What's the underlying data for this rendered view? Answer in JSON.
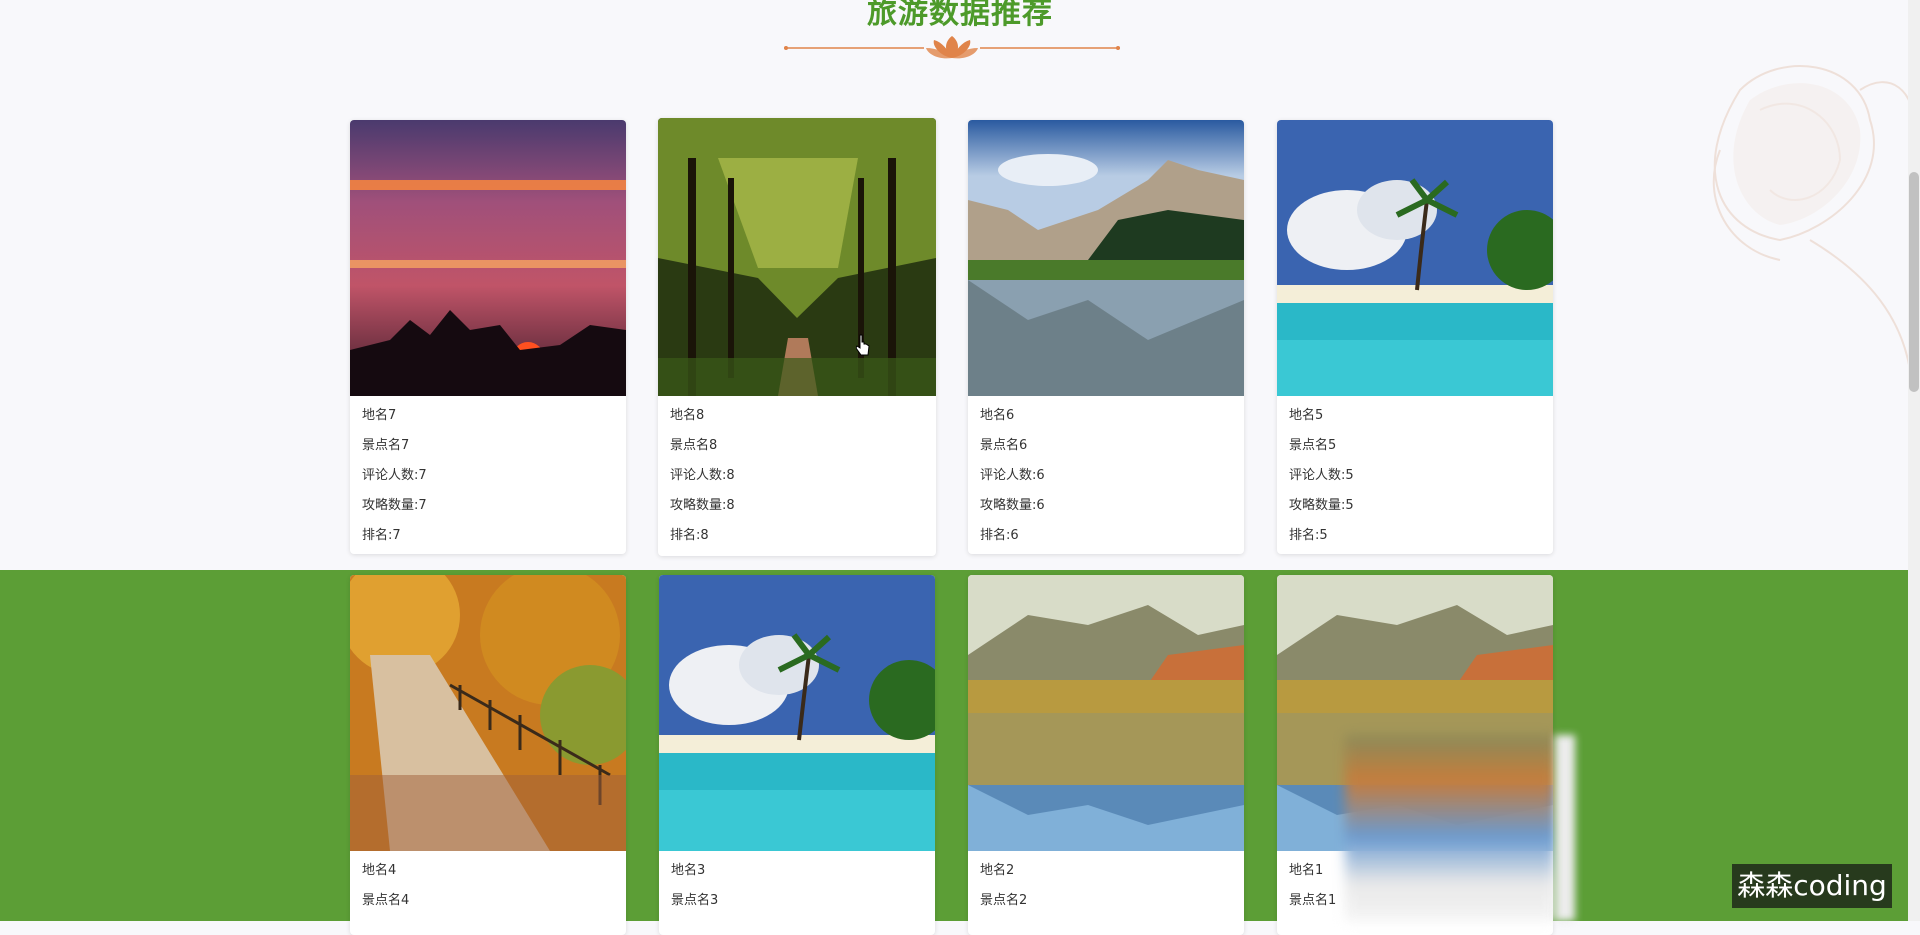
{
  "section": {
    "title": "旅游数据推荐"
  },
  "cards_row1": [
    {
      "place": "地名7",
      "spot": "景点名7",
      "comments": "评论人数:7",
      "guides": "攻略数量:7",
      "rank": "排名:7",
      "image": "sunset-trees-photo"
    },
    {
      "place": "地名8",
      "spot": "景点名8",
      "comments": "评论人数:8",
      "guides": "攻略数量:8",
      "rank": "排名:8",
      "image": "tree-lined-road-photo"
    },
    {
      "place": "地名6",
      "spot": "景点名6",
      "comments": "评论人数:6",
      "guides": "攻略数量:6",
      "rank": "排名:6",
      "image": "mountain-lake-photo"
    },
    {
      "place": "地名5",
      "spot": "景点名5",
      "comments": "评论人数:5",
      "guides": "攻略数量:5",
      "rank": "排名:5",
      "image": "tropical-beach-photo"
    }
  ],
  "cards_row2": [
    {
      "place": "地名4",
      "spot": "景点名4",
      "image": "autumn-path-photo"
    },
    {
      "place": "地名3",
      "spot": "景点名3",
      "image": "tropical-beach-photo"
    },
    {
      "place": "地名2",
      "spot": "景点名2",
      "image": "lake-reflection-photo"
    },
    {
      "place": "地名1",
      "spot": "景点名1",
      "image": "lake-reflection-photo"
    }
  ],
  "watermark": "森森coding",
  "colors": {
    "title_green": "#4d9a2a",
    "band_green": "#5c9e36",
    "divider_orange": "#e0844a"
  }
}
